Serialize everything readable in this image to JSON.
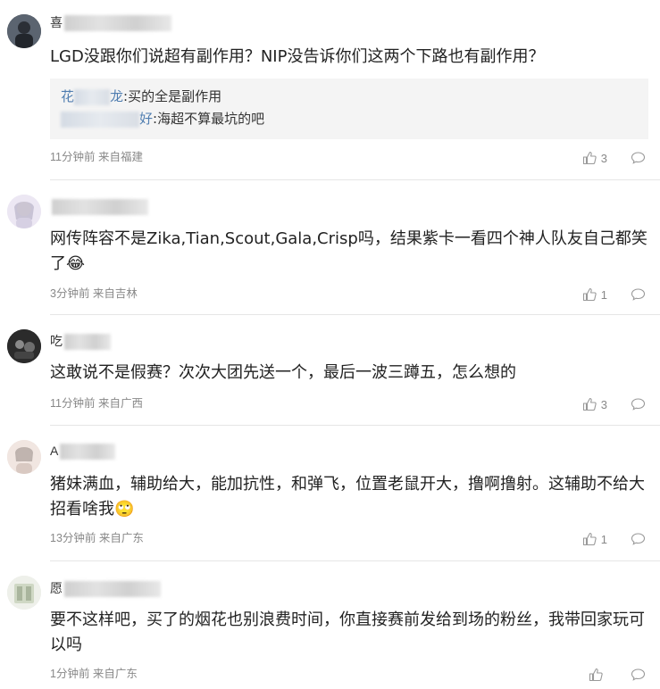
{
  "comments": [
    {
      "name_visible": "喜",
      "text": "LGD没跟你们说超有副作用？NIP没告诉你们这两个下路也有副作用？",
      "replies": [
        {
          "name_prefix": "花",
          "name_suffix": "龙",
          "text": ":买的全是副作用"
        },
        {
          "name_prefix": "",
          "name_suffix": "好",
          "text": ":海超不算最坑的吧"
        }
      ],
      "meta": "11分钟前 来自福建",
      "likes": "3"
    },
    {
      "name_visible": "",
      "text": "网传阵容不是Zika,Tian,Scout,Gala,Crisp吗，结果紫卡一看四个神人队友自己都笑了😂",
      "meta": "3分钟前 来自吉林",
      "likes": "1"
    },
    {
      "name_visible": "吃",
      "text": "这敢说不是假赛？次次大团先送一个，最后一波三蹲五，怎么想的",
      "meta": "11分钟前 来自广西",
      "likes": "3"
    },
    {
      "name_visible": "A",
      "text": "猪妹满血，辅助给大，能加抗性，和弹飞，位置老鼠开大，撸啊撸射。这辅助不给大招看啥我🙄",
      "meta": "13分钟前 来自广东",
      "likes": "1"
    },
    {
      "name_visible": "愿",
      "text": "要不这样吧，买了的烟花也别浪费时间，你直接赛前发给到场的粉丝，我带回家玩可以吗",
      "meta": "1分钟前 来自广东",
      "likes": ""
    }
  ],
  "icons": {
    "like": "thumbs-up-icon",
    "reply": "comment-bubble-icon"
  },
  "colors": {
    "reply_name": "#4f7db0",
    "meta": "#888888",
    "reply_bg": "#f4f4f4"
  }
}
